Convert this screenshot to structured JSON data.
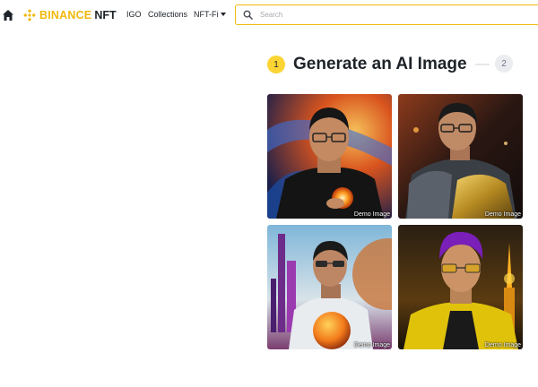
{
  "header": {
    "brand": "BINANCE",
    "brand_suffix": "NFT",
    "nav": [
      {
        "label": "IGO"
      },
      {
        "label": "Collections"
      },
      {
        "label": "NFT-Fi"
      }
    ],
    "search_placeholder": "Search"
  },
  "colors": {
    "accent": "#f0b90b",
    "step_active": "#fcd535",
    "text": "#1e2329"
  },
  "steps": [
    {
      "number": "1",
      "title": "Generate an AI Image",
      "active": true
    },
    {
      "number": "2",
      "active": false
    }
  ],
  "gallery": [
    {
      "caption": "Demo Image"
    },
    {
      "caption": "Demo Image"
    },
    {
      "caption": "Demo Image"
    },
    {
      "caption": "Demo Image"
    }
  ]
}
